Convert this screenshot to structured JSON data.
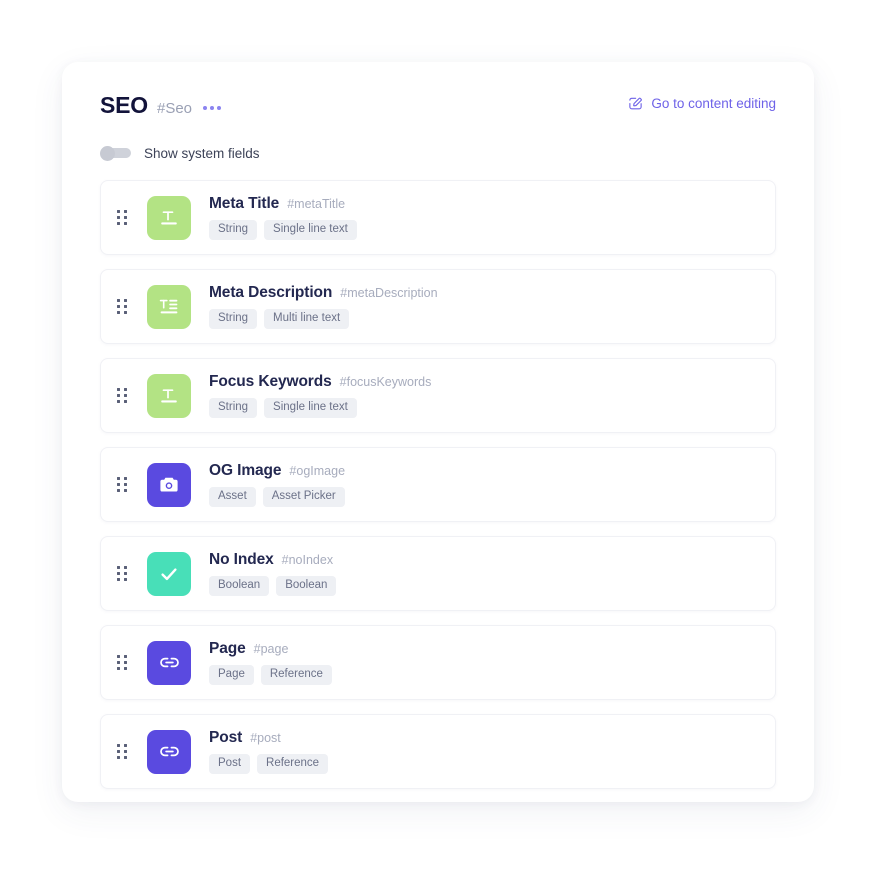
{
  "header": {
    "title": "SEO",
    "api_id": "#Seo",
    "overflow_menu_icon": "three-dots-icon",
    "edit_link": {
      "label": "Go to content editing",
      "icon": "edit-square-icon",
      "color": "#6e62e8"
    }
  },
  "system_fields_toggle": {
    "label": "Show system fields",
    "state": "off"
  },
  "fields": [
    {
      "name": "Meta Title",
      "api_id": "#metaTitle",
      "icon": "single-line-text-icon",
      "tile_color": "#b3e384",
      "tags": [
        "String",
        "Single line text"
      ]
    },
    {
      "name": "Meta Description",
      "api_id": "#metaDescription",
      "icon": "multi-line-text-icon",
      "tile_color": "#b3e384",
      "tags": [
        "String",
        "Multi line text"
      ]
    },
    {
      "name": "Focus Keywords",
      "api_id": "#focusKeywords",
      "icon": "single-line-text-icon",
      "tile_color": "#b3e384",
      "tags": [
        "String",
        "Single line text"
      ]
    },
    {
      "name": "OG Image",
      "api_id": "#ogImage",
      "icon": "camera-icon",
      "tile_color": "#5a4ae0",
      "tags": [
        "Asset",
        "Asset Picker"
      ]
    },
    {
      "name": "No Index",
      "api_id": "#noIndex",
      "icon": "check-icon",
      "tile_color": "#48dfb8",
      "tags": [
        "Boolean",
        "Boolean"
      ]
    },
    {
      "name": "Page",
      "api_id": "#page",
      "icon": "link-icon",
      "tile_color": "#5a4ae0",
      "tags": [
        "Page",
        "Reference"
      ]
    },
    {
      "name": "Post",
      "api_id": "#post",
      "icon": "link-icon",
      "tile_color": "#5a4ae0",
      "tags": [
        "Post",
        "Reference"
      ]
    }
  ]
}
